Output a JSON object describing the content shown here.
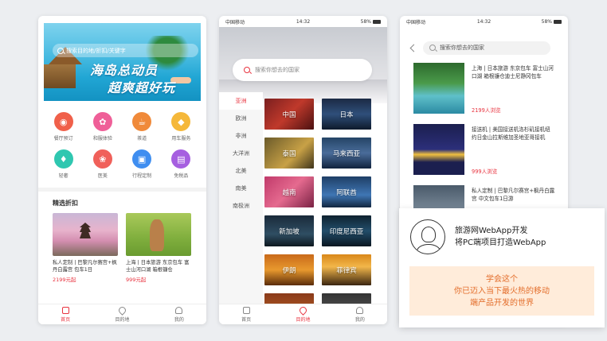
{
  "phone1": {
    "search_placeholder": "搜索目的地/折扣/关键字",
    "banner_line1": "海岛总动员",
    "banner_line2": "超爽超好玩",
    "categories": [
      {
        "label": "餐厅预订",
        "icon": "food-icon",
        "color": "#f0604a"
      },
      {
        "label": "和服体验",
        "icon": "kimono-icon",
        "color": "#ef5f98"
      },
      {
        "label": "茶道",
        "icon": "tea-icon",
        "color": "#f08a3a"
      },
      {
        "label": "用车服务",
        "icon": "car-icon",
        "color": "#f5b83a"
      },
      {
        "label": "轻奢",
        "icon": "diamond-icon",
        "color": "#2fc7b0"
      },
      {
        "label": "医美",
        "icon": "beauty-icon",
        "color": "#f0605a"
      },
      {
        "label": "行程定制",
        "icon": "itinerary-icon",
        "color": "#3f8ef0"
      },
      {
        "label": "免税品",
        "icon": "bag-icon",
        "color": "#a65fe0"
      }
    ],
    "section_title": "精选折扣",
    "deals": [
      {
        "text": "私人定制 | 巴黎凡尔赛宫+枫丹白露宫 包车1日",
        "price": "2199元起"
      },
      {
        "text": "上海 | 日本旅游 东京包车 富士山河口湖 箱根镰仓",
        "price": "999元起"
      }
    ],
    "tabs": [
      "首页",
      "目的地",
      "我的"
    ]
  },
  "phone2": {
    "carrier": "中国移动",
    "time": "14:32",
    "battery": "58%",
    "search_placeholder": "搜索你想去的国家",
    "continents": [
      "亚洲",
      "欧洲",
      "非洲",
      "大洋洲",
      "北美",
      "南美",
      "南极洲"
    ],
    "countries": [
      "中国",
      "日本",
      "泰国",
      "马来西亚",
      "越南",
      "阿联酋",
      "新加坡",
      "印度尼西亚",
      "伊朗",
      "菲律宾",
      "",
      ""
    ],
    "tabs": [
      "首页",
      "目的地",
      "我的"
    ]
  },
  "phone3": {
    "carrier": "中国移动",
    "time": "14:32",
    "battery": "58%",
    "search_placeholder": "搜索你想去的国家",
    "items": [
      {
        "text": "上海 | 日本旅游 东京包车 富士山河口湖 箱根镰仓迪士尼静冈包车",
        "views": "2199人浏览"
      },
      {
        "text": "接送机 | 美国接送机洛杉矶接机纽约日金山拉斯维加圣地亚哥接机",
        "views": "999人浏览"
      },
      {
        "text": "私人定制 | 巴黎凡尔赛宫+枫丹白露宫 中文包车1日游",
        "views": ""
      }
    ]
  },
  "overlay": {
    "title_line1": "旅游网WebApp开发",
    "title_line2": "将PC端项目打造WebApp",
    "box_line1": "学会这个",
    "box_line2": "你已迈入当下最火热的移动",
    "box_line3": "端产品开发的世界"
  }
}
